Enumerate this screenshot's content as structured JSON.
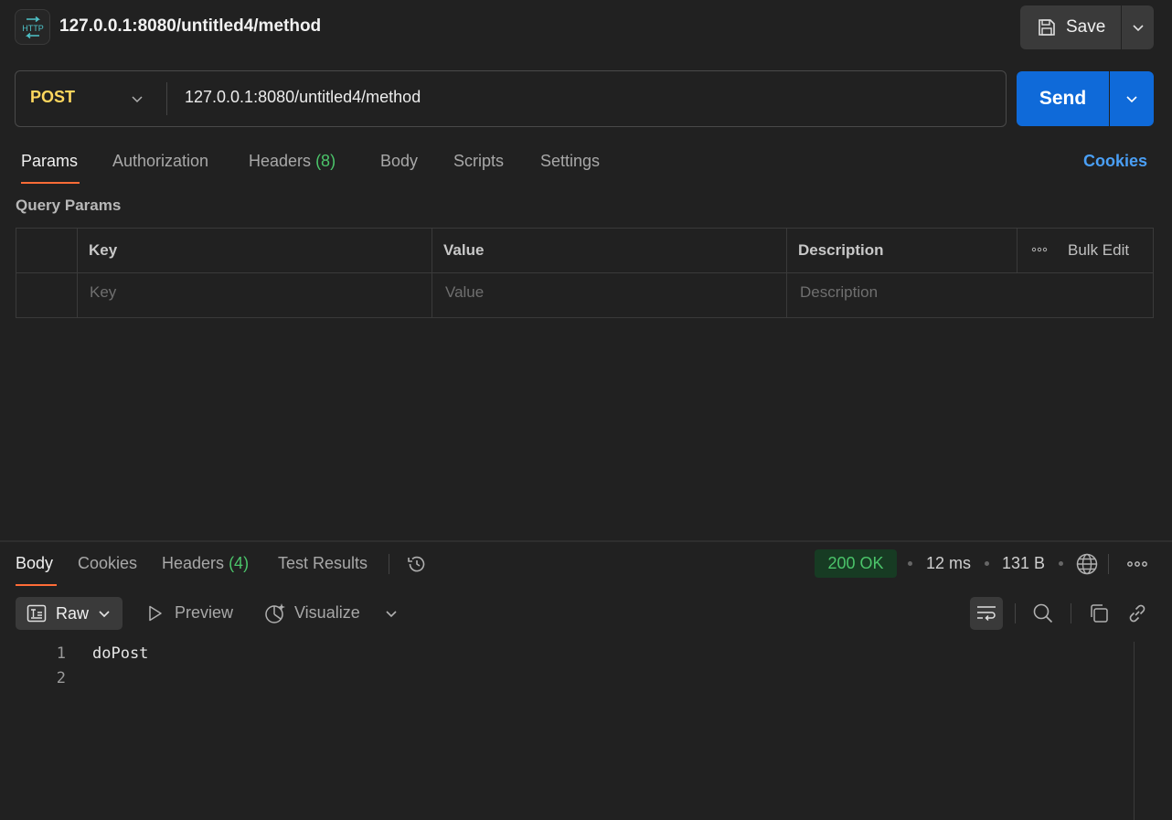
{
  "header": {
    "badge_text": "HTTP",
    "title": "127.0.0.1:8080/untitled4/method",
    "save_label": "Save"
  },
  "request": {
    "method": "POST",
    "url": "127.0.0.1:8080/untitled4/method",
    "send_label": "Send"
  },
  "request_tabs": {
    "params": "Params",
    "authorization": "Authorization",
    "headers": "Headers",
    "headers_count": "(8)",
    "body": "Body",
    "scripts": "Scripts",
    "settings": "Settings",
    "cookies": "Cookies"
  },
  "query_params": {
    "title": "Query Params",
    "columns": {
      "key": "Key",
      "value": "Value",
      "description": "Description"
    },
    "bulk_edit": "Bulk Edit",
    "placeholders": {
      "key": "Key",
      "value": "Value",
      "description": "Description"
    }
  },
  "response_tabs": {
    "body": "Body",
    "cookies": "Cookies",
    "headers": "Headers",
    "headers_count": "(4)",
    "test_results": "Test Results"
  },
  "response_meta": {
    "status": "200 OK",
    "time": "12 ms",
    "size": "131 B"
  },
  "response_toolbar": {
    "format": "Raw",
    "preview": "Preview",
    "visualize": "Visualize"
  },
  "response_body": {
    "lines": [
      {
        "num": "1",
        "text": "doPost"
      },
      {
        "num": "2",
        "text": ""
      }
    ]
  },
  "colors": {
    "background": "#212121",
    "accent": "#ff6c37",
    "send": "#0f6ad9",
    "method": "#ffd75e",
    "success": "#4bc46a",
    "link": "#4a9ff5"
  }
}
